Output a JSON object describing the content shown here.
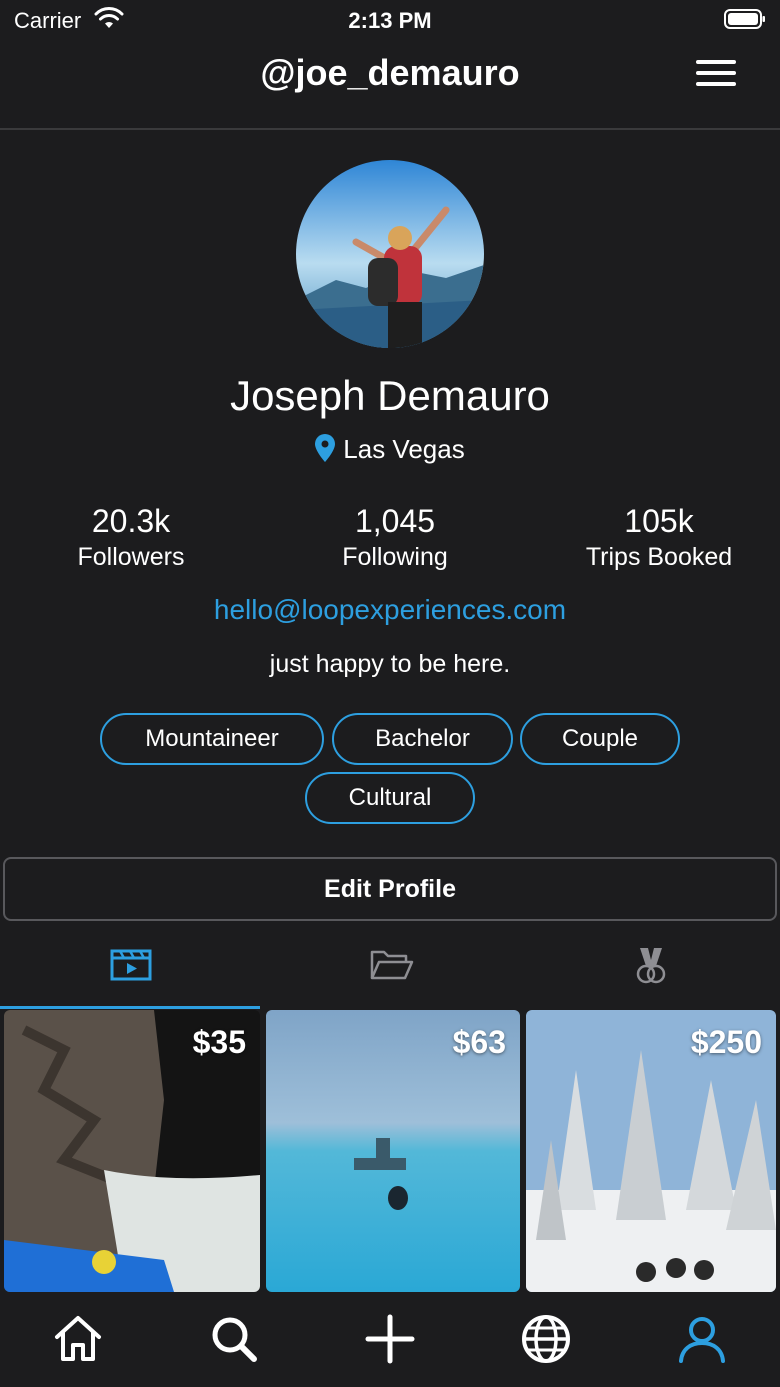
{
  "status_bar": {
    "carrier": "Carrier",
    "time": "2:13 PM"
  },
  "header": {
    "username": "@joe_demauro"
  },
  "profile": {
    "name": "Joseph Demauro",
    "location": "Las Vegas",
    "email": "hello@loopexperiences.com",
    "bio": "just happy to be here."
  },
  "stats": [
    {
      "value": "20.3k",
      "label": "Followers"
    },
    {
      "value": "1,045",
      "label": "Following"
    },
    {
      "value": "105k",
      "label": "Trips Booked"
    }
  ],
  "tags": [
    "Mountaineer",
    "Bachelor",
    "Couple",
    "Cultural"
  ],
  "edit_profile_label": "Edit Profile",
  "content_tabs": [
    {
      "icon": "video-icon",
      "active": true
    },
    {
      "icon": "folder-icon",
      "active": false
    },
    {
      "icon": "medal-icon",
      "active": false
    }
  ],
  "experiences": [
    {
      "price": "$35",
      "image": "kayak-waterfall"
    },
    {
      "price": "$63",
      "image": "blue-lagoon"
    },
    {
      "price": "$250",
      "image": "snowy-forest-sled-dogs"
    }
  ],
  "bottom_nav": [
    {
      "icon": "home-icon",
      "active": false
    },
    {
      "icon": "search-icon",
      "active": false
    },
    {
      "icon": "plus-icon",
      "active": false
    },
    {
      "icon": "globe-icon",
      "active": false
    },
    {
      "icon": "profile-icon",
      "active": true
    }
  ],
  "colors": {
    "accent": "#2d9fe0",
    "background": "#1c1c1e",
    "inactive_icon": "#8e8e93"
  }
}
